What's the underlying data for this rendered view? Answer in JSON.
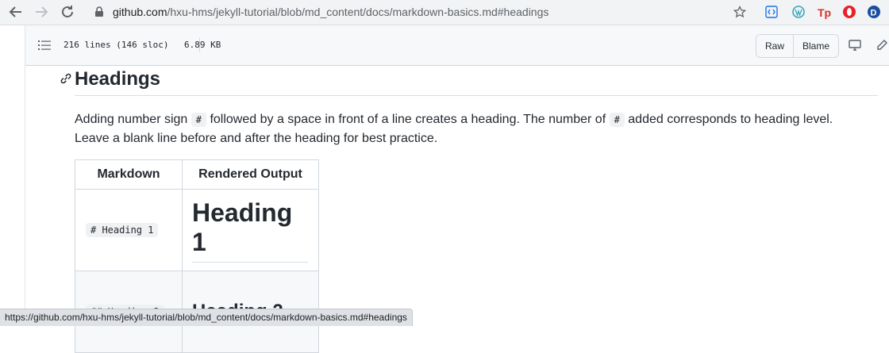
{
  "browser": {
    "url_host": "github.com",
    "url_path": "/hxu-hms/jekyll-tutorial/blob/md_content/docs/markdown-basics.md#headings",
    "status_url": "https://github.com/hxu-hms/jekyll-tutorial/blob/md_content/docs/markdown-basics.md#headings"
  },
  "file": {
    "lines": "216 lines (146 sloc)",
    "size": "6.89 KB",
    "raw_label": "Raw",
    "blame_label": "Blame"
  },
  "content": {
    "heading": "Headings",
    "para_1": "Adding number sign",
    "para_code_1": "#",
    "para_2": "followed by a space in front of a line creates a heading. The number of",
    "para_code_2": "#",
    "para_3": "added corresponds to heading level.",
    "para_4": "Leave a blank line before and after the heading for best practice.",
    "table": {
      "headers": [
        "Markdown",
        "Rendered Output"
      ],
      "rows": [
        {
          "markdown": "# Heading 1",
          "output": "Heading 1"
        },
        {
          "markdown": "## Heading 2",
          "output": "Heading 2"
        }
      ]
    }
  },
  "colors": {
    "link_blue": "#0969da",
    "border": "#d0d7de"
  }
}
